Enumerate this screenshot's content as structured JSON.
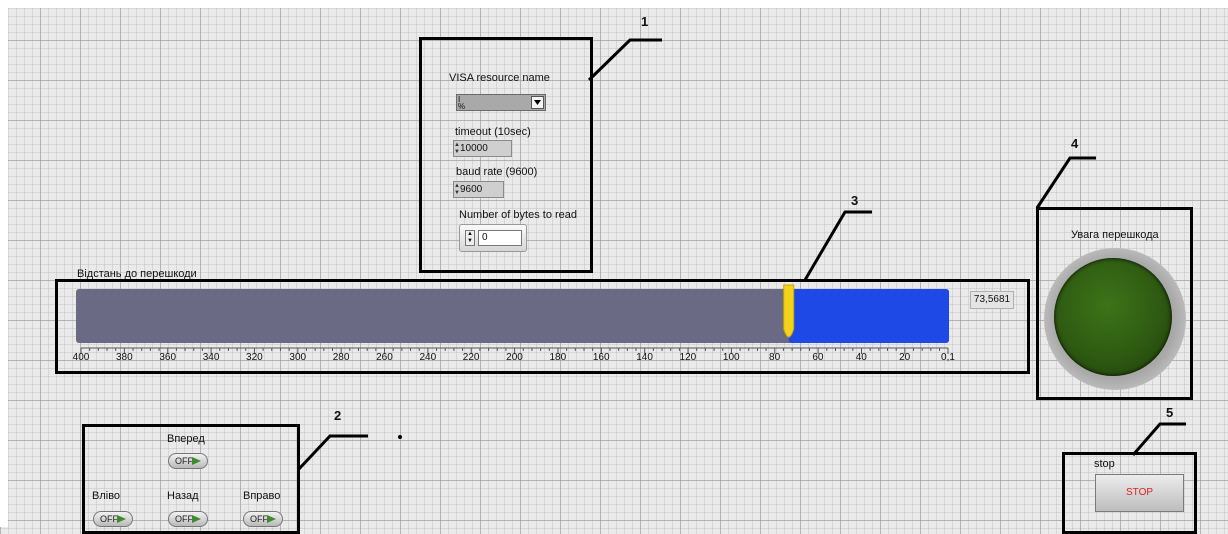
{
  "callouts": [
    "1",
    "2",
    "3",
    "4",
    "5"
  ],
  "visa_panel": {
    "resource_label": "VISA resource name",
    "resource_value": "",
    "resource_icon": "io-icon",
    "timeout_label": "timeout (10sec)",
    "timeout_value": "10000",
    "baud_label": "baud rate (9600)",
    "baud_value": "9600",
    "bytes_label": "Number of bytes to read",
    "bytes_value": "0"
  },
  "slide": {
    "label": "Відстань до перешкоди",
    "value": 73.5681,
    "display_value": "73,5681",
    "scale_max": 400,
    "scale_min": 0.1,
    "tick_labels": [
      "400",
      "380",
      "360",
      "340",
      "320",
      "300",
      "280",
      "260",
      "240",
      "220",
      "200",
      "180",
      "160",
      "140",
      "120",
      "100",
      "80",
      "60",
      "40",
      "20",
      "0,1"
    ],
    "fill_color": "#1f49e6",
    "track_color": "#6b6a84",
    "pointer_color": "#f2d21a"
  },
  "direction_panel": {
    "forward_label": "Вперед",
    "back_label": "Назад",
    "left_label": "Вліво",
    "right_label": "Вправо",
    "toggle_text": "OFF"
  },
  "warning": {
    "label": "Увага перешкода",
    "led_color": "#2e5a12"
  },
  "stop_control": {
    "label": "stop",
    "button_text": "STOP",
    "text_color": "#e02020"
  }
}
